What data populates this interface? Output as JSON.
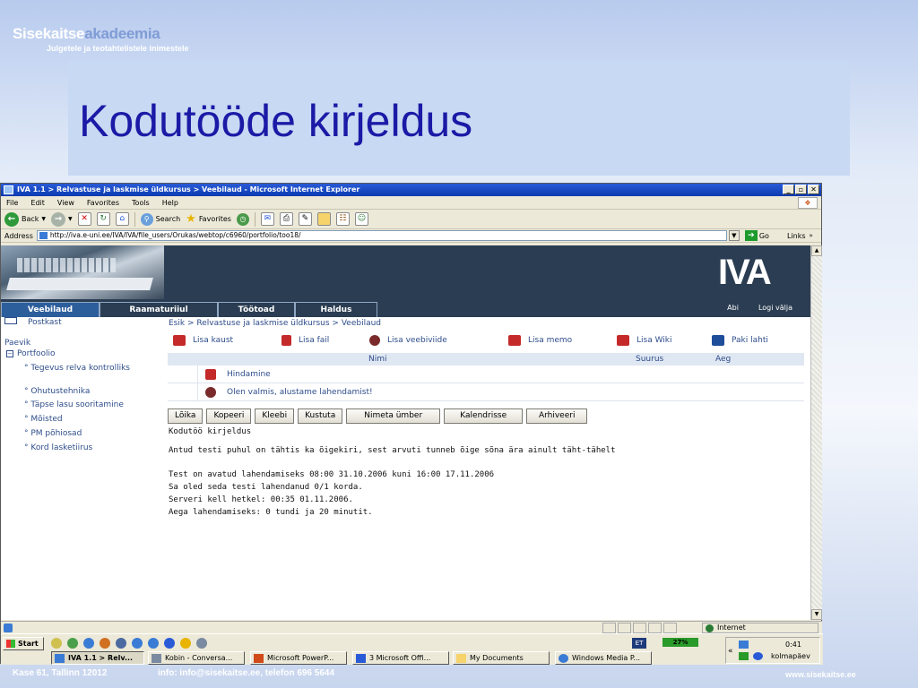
{
  "slide": {
    "logo_main": "Sisekaitse",
    "logo_accent": "akadeemia",
    "logo_tagline": "Julgetele ja teotahtelistele inimestele",
    "title": "Kodutööde kirjeldus",
    "footer_address": "Kase 61, Tallinn 12012",
    "footer_contact": "info: info@sisekaitse.ee, telefon 696 5644",
    "footer_url": "www.sisekaitse.ee"
  },
  "browser": {
    "window_title": "IVA 1.1 > Relvastuse ja laskmise üldkursus > Veebilaud - Microsoft Internet Explorer",
    "menu": [
      "File",
      "Edit",
      "View",
      "Favorites",
      "Tools",
      "Help"
    ],
    "toolbar": {
      "back": "Back",
      "search": "Search",
      "favorites": "Favorites"
    },
    "address_label": "Address",
    "address_url": "http://iva.e-uni.ee/IVA/IVA/file_users/Orukas/webtop/c6960/portfolio/too18/",
    "go_label": "Go",
    "links_label": "Links",
    "status_zone": "Internet"
  },
  "site": {
    "logo": "IVA",
    "nav_tabs": [
      "Veebilaud",
      "Raamaturiiul",
      "Töötoad",
      "Haldus"
    ],
    "nav_right": [
      "Abi",
      "Logi välja"
    ],
    "breadcrumb": "Esik > Relvastuse ja laskmise üldkursus > Veebilaud",
    "sidebar": {
      "postkast": "Postkast",
      "paevik": "Paevik",
      "portfoolio": "Portfoolio",
      "items": [
        "Tegevus relva kontrolliks",
        "Ohutustehnika",
        "Täpse lasu sooritamine",
        "Mõisted",
        "PM põhiosad",
        "Kord lasketiirus"
      ]
    },
    "actions": [
      "Lisa kaust",
      "Lisa fail",
      "Lisa veebiviide",
      "Lisa memo",
      "Lisa Wiki",
      "Paki lahti"
    ],
    "table": {
      "headers": [
        "Nimi",
        "Suurus",
        "Aeg"
      ],
      "rows": [
        "Hindamine",
        "Olen valmis, alustame lahendamist!"
      ]
    },
    "buttons": [
      "Lõika",
      "Kopeeri",
      "Kleebi",
      "Kustuta",
      "Nimeta ümber",
      "Kalendrisse",
      "Arhiveeri"
    ],
    "item_title": "Kodutöö kirjeldus",
    "instruction": "Antud testi puhul on tähtis ka õigekiri, sest arvuti tunneb õige sõna ära ainult täht-tähelt",
    "info_lines": [
      "Test on avatud lahendamiseks 08:00 31.10.2006 kuni 16:00 17.11.2006",
      "Sa oled seda testi lahendanud 0/1 korda.",
      "Serveri kell hetkel: 00:35 01.11.2006.",
      "Aega lahendamiseks: 0 tundi ja 20 minutit."
    ]
  },
  "taskbar": {
    "start": "Start",
    "buttons": [
      "IVA 1.1 > Relv...",
      "Kobin - Conversa...",
      "Microsoft PowerP...",
      "3 Microsoft Offi...",
      "My Documents",
      "Windows Media P..."
    ],
    "lang": "ET",
    "battery": "27%",
    "time": "0:41",
    "day": "kolmapäev"
  },
  "colors": {
    "title": "#1a1aa6",
    "link": "#2e4d8a",
    "nav_bg": "#2b3d52",
    "nav_active": "#2d5e9c"
  }
}
